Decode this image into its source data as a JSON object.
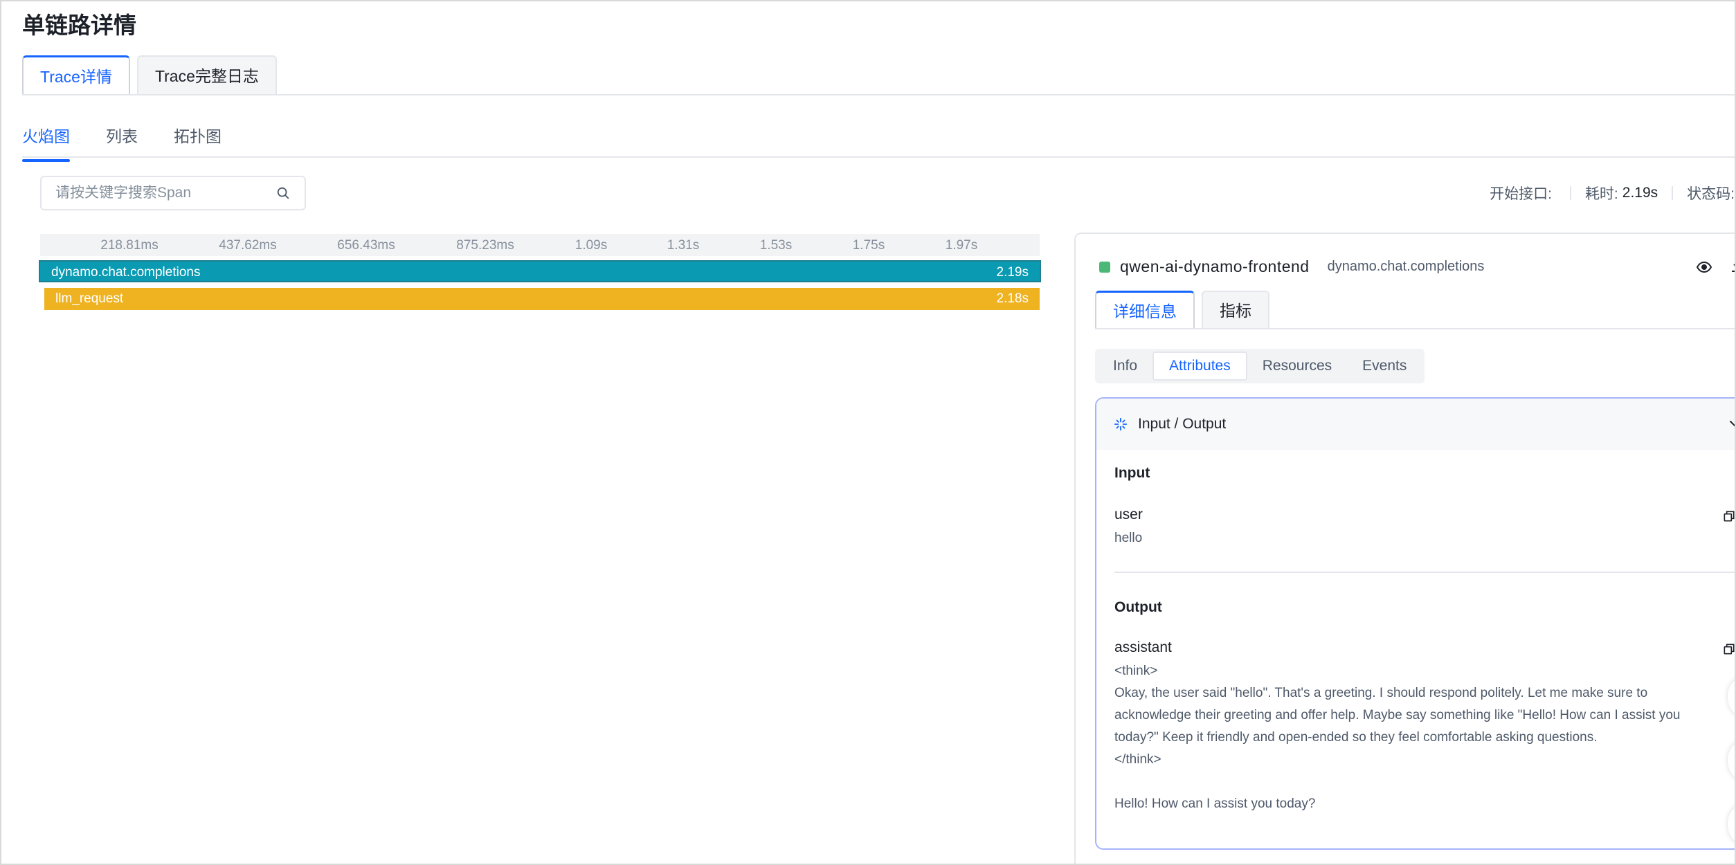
{
  "page": {
    "title": "单链路详情"
  },
  "top_tabs": [
    {
      "label": "Trace详情",
      "active": true
    },
    {
      "label": "Trace完整日志",
      "active": false
    }
  ],
  "view_tabs": [
    {
      "label": "火焰图",
      "active": true
    },
    {
      "label": "列表",
      "active": false
    },
    {
      "label": "拓扑图",
      "active": false
    }
  ],
  "search": {
    "placeholder": "请按关键字搜索Span",
    "value": ""
  },
  "stats": {
    "start_label": "开始接口:",
    "start_value": "",
    "duration_label": "耗时:",
    "duration_value": "2.19s",
    "status_label": "状态码:"
  },
  "flame": {
    "ticks": [
      "218.81ms",
      "437.62ms",
      "656.43ms",
      "875.23ms",
      "1.09s",
      "1.31s",
      "1.53s",
      "1.75s",
      "1.97s"
    ],
    "spans": [
      {
        "name": "dynamo.chat.completions",
        "duration": "2.19s",
        "color": "#0a9bb3"
      },
      {
        "name": "llm_request",
        "duration": "2.18s",
        "color": "#efb322"
      }
    ]
  },
  "detail": {
    "service_name": "qwen-ai-dynamo-frontend",
    "operation": "dynamo.chat.completions",
    "service_color": "#4cb877",
    "tabs": [
      {
        "label": "详细信息",
        "active": true
      },
      {
        "label": "指标",
        "active": false
      }
    ],
    "segments": [
      {
        "label": "Info",
        "active": false
      },
      {
        "label": "Attributes",
        "active": true
      },
      {
        "label": "Resources",
        "active": false
      },
      {
        "label": "Events",
        "active": false
      }
    ],
    "io": {
      "title": "Input / Output",
      "input_title": "Input",
      "input_role": "user",
      "input_text": "hello",
      "output_title": "Output",
      "output_role": "assistant",
      "output_text": "<think>\nOkay, the user said \"hello\". That's a greeting. I should respond politely. Let me make sure to acknowledge their greeting and offer help. Maybe say something like \"Hello! How can I assist you today?\" Keep it friendly and open-ended so they feel comfortable asking questions.\n</think>\n\nHello! How can I assist you today?"
    }
  }
}
